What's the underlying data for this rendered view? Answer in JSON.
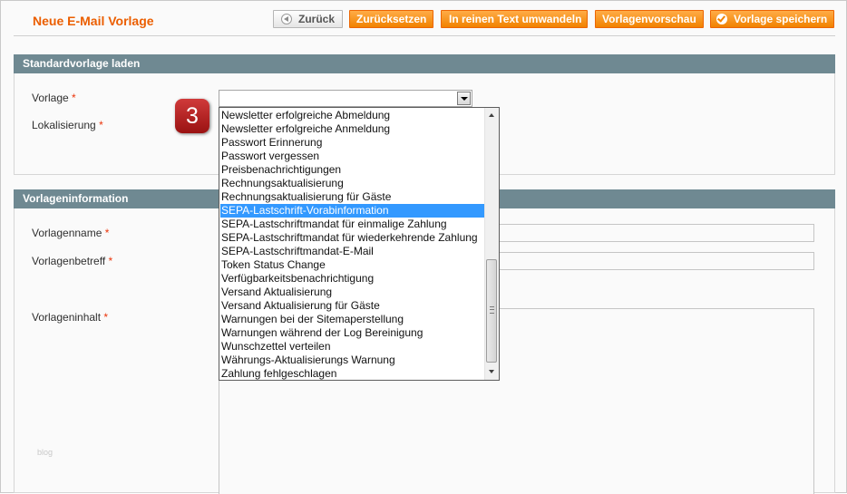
{
  "header": {
    "title": "Neue E-Mail Vorlage",
    "buttons": {
      "back": "Zurück",
      "reset": "Zurücksetzen",
      "plain_text": "In reinen Text umwandeln",
      "preview": "Vorlagenvorschau",
      "save": "Vorlage speichern"
    }
  },
  "load_section": {
    "title": "Standardvorlage laden",
    "template_label": "Vorlage",
    "locale_label": "Lokalisierung",
    "required_mark": "*",
    "template_value": ""
  },
  "info_section": {
    "title": "Vorlageninformation",
    "name_label": "Vorlagenname",
    "subject_label": "Vorlagenbetreff",
    "content_label": "Vorlageninhalt",
    "required_mark": "*"
  },
  "step_badge": "3",
  "dropdown": {
    "selected_index": 7,
    "options": [
      "Newsletter erfolgreiche Abmeldung",
      "Newsletter erfolgreiche Anmeldung",
      "Passwort Erinnerung",
      "Passwort vergessen",
      "Preisbenachrichtigungen",
      "Rechnungsaktualisierung",
      "Rechnungsaktualisierung für Gäste",
      "SEPA-Lastschrift-Vorabinformation",
      "SEPA-Lastschriftmandat für einmalige Zahlung",
      "SEPA-Lastschriftmandat für wiederkehrende Zahlung",
      "SEPA-Lastschriftmandat-E-Mail",
      "Token Status Change",
      "Verfügbarkeitsbenachrichtigung",
      "Versand Aktualisierung",
      "Versand Aktualisierung für Gäste",
      "Warnungen bei der Sitemaperstellung",
      "Warnungen während der Log Bereinigung",
      "Wunschzettel verteilen",
      "Währungs-Aktualisierungs Warnung",
      "Zahlung fehlgeschlagen"
    ]
  },
  "watermark": "blog",
  "colors": {
    "accent": "#eb5e00",
    "button": "#f18200",
    "section_header": "#6f8992",
    "selection": "#3399ff",
    "required": "#eb340a"
  }
}
